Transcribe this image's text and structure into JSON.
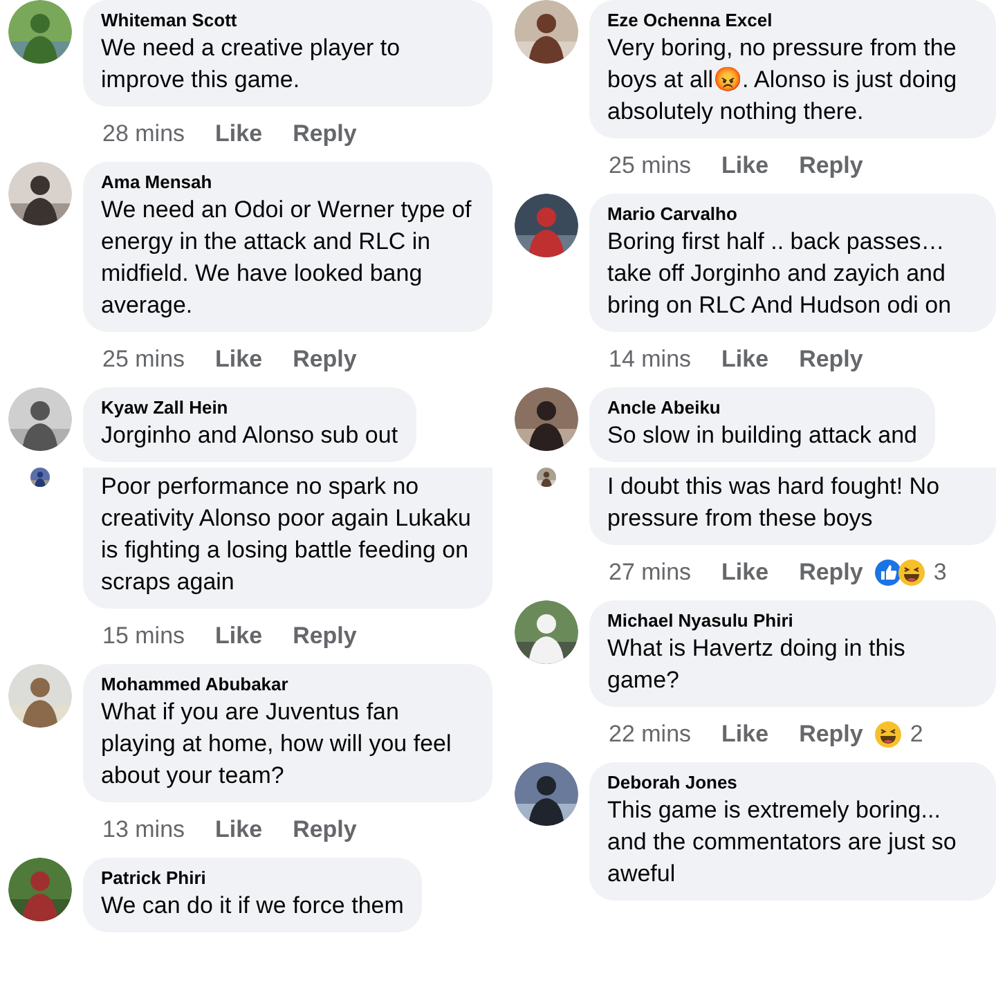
{
  "columns": [
    {
      "segments": [
        {
          "comments": [
            {
              "author": "Whiteman Scott",
              "text": "We need a creative player to improve this game.",
              "time": "28 mins",
              "like": "Like",
              "reply": "Reply"
            },
            {
              "author": "Ama Mensah",
              "text": "We need an Odoi or Werner type of energy in the attack and RLC in midfield. We have looked bang average.",
              "time": "25 mins",
              "like": "Like",
              "reply": "Reply"
            },
            {
              "author": "Kyaw Zall Hein",
              "text": "Jorginho and Alonso sub out"
            }
          ]
        },
        {
          "comments": [
            {
              "text": "Poor performance no spark no creativity Alonso poor again Lukaku is fighting a losing battle feeding on scraps again",
              "time": "15 mins",
              "like": "Like",
              "reply": "Reply"
            },
            {
              "author": "Mohammed Abubakar",
              "text": "What if you are Juventus fan playing at home, how will you feel about your team?",
              "time": "13 mins",
              "like": "Like",
              "reply": "Reply"
            },
            {
              "author": "Patrick Phiri",
              "text": "We can do it if we force them"
            }
          ]
        }
      ]
    },
    {
      "segments": [
        {
          "comments": [
            {
              "author": "Eze Ochenna Excel",
              "text": "Very boring, no pressure from the boys at all😡. Alonso is just doing absolutely nothing there.",
              "time": "25 mins",
              "like": "Like",
              "reply": "Reply"
            },
            {
              "author": "Mario Carvalho",
              "text": "Boring first half .. back passes… take off Jorginho and zayich and bring on RLC And Hudson odi on",
              "time": "14 mins",
              "like": "Like",
              "reply": "Reply"
            },
            {
              "author": "Ancle Abeiku",
              "text": "So slow in building attack and"
            }
          ]
        },
        {
          "comments": [
            {
              "text": "I doubt this was hard fought! No pressure from these boys",
              "time": "27 mins",
              "like": "Like",
              "reply": "Reply",
              "reactions": [
                {
                  "kind": "like"
                },
                {
                  "kind": "haha"
                }
              ],
              "reaction_count": "3"
            },
            {
              "author": "Michael Nyasulu Phiri",
              "text": "What is Havertz doing in this game?",
              "time": "22 mins",
              "like": "Like",
              "reply": "Reply",
              "reactions": [
                {
                  "kind": "haha"
                }
              ],
              "reaction_count": "2"
            },
            {
              "author": "Deborah Jones",
              "text": "This game is extremely boring... and the commentators are just so aweful"
            }
          ]
        }
      ]
    }
  ]
}
